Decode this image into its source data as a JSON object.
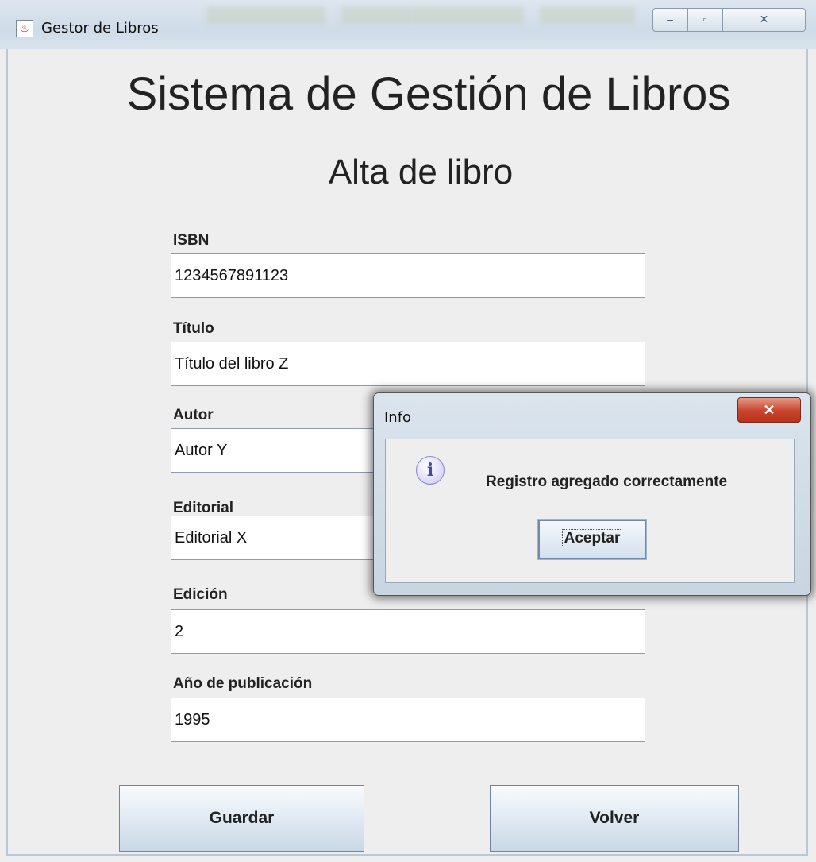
{
  "window": {
    "title": "Gestor de Libros",
    "controls": {
      "minimize": "–",
      "maximize": "▫",
      "close": "✕"
    }
  },
  "main": {
    "app_title": "Sistema de Gestión de Libros",
    "subtitle": "Alta de libro",
    "fields": [
      {
        "label": "ISBN",
        "value": "1234567891123"
      },
      {
        "label": "Título",
        "value": "Título del libro Z"
      },
      {
        "label": "Autor",
        "value": "Autor Y"
      },
      {
        "label": "Editorial",
        "value": "Editorial X"
      },
      {
        "label": "Edición",
        "value": "2"
      },
      {
        "label": "Año de publicación",
        "value": "1995"
      }
    ],
    "buttons": {
      "save": "Guardar",
      "back": "Volver"
    }
  },
  "dialog": {
    "title": "Info",
    "close_icon": "close-icon",
    "icon": "info-icon",
    "message": "Registro agregado correctamente",
    "accept_label": "Aceptar"
  }
}
